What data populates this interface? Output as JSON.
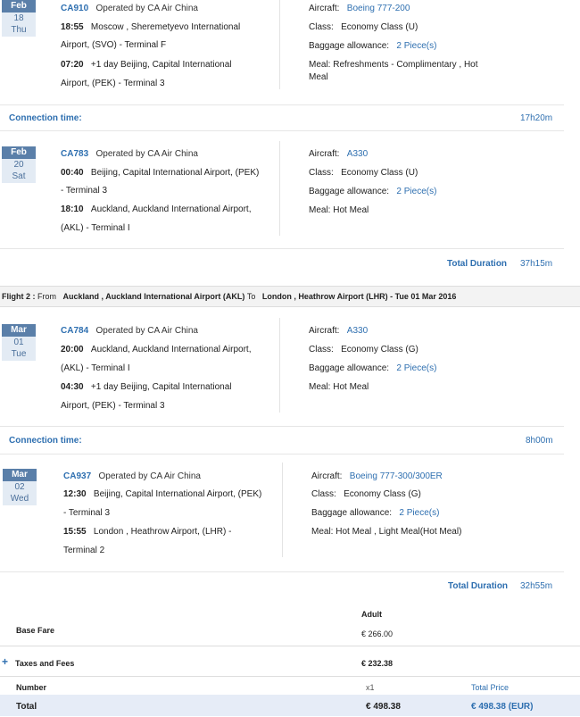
{
  "segments": [
    {
      "month": "Feb",
      "day": "18",
      "weekday": "Thu",
      "code": "CA910",
      "operated_by": "Operated by  CA Air China",
      "dep_time": "18:55",
      "dep_line1": "Moscow , Sheremetyevo International",
      "dep_line2": "Airport, (SVO)   -   Terminal F",
      "arr_time": "07:20",
      "arr_line1": "+1 day Beijing, Capital International",
      "arr_line2": "Airport, (PEK) -    Terminal 3",
      "aircraft_label": "Aircraft:",
      "aircraft": "Boeing 777-200",
      "class_label": "Class:",
      "class": "Economy Class (U)",
      "baggage_label": "Baggage allowance:",
      "baggage": "2 Piece(s)",
      "meal_line1": "Meal: Refreshments - Complimentary , Hot",
      "meal_line2": "Meal"
    },
    {
      "month": "Feb",
      "day": "20",
      "weekday": "Sat",
      "code": "CA783",
      "operated_by": "Operated by  CA Air China",
      "dep_time": "00:40",
      "dep_line1": "Beijing, Capital International Airport, (PEK)",
      "dep_line2": "  -   Terminal 3",
      "arr_time": "18:10",
      "arr_line1": "Auckland, Auckland International Airport,",
      "arr_line2": "(AKL) -    Terminal I",
      "aircraft_label": "Aircraft:",
      "aircraft": "A330",
      "class_label": "Class:",
      "class": "Economy Class (U)",
      "baggage_label": "Baggage allowance:",
      "baggage": "2 Piece(s)",
      "meal_line1": "Meal: Hot Meal",
      "meal_line2": ""
    },
    {
      "month": "Mar",
      "day": "01",
      "weekday": "Tue",
      "code": "CA784",
      "operated_by": "Operated by  CA Air China",
      "dep_time": "20:00",
      "dep_line1": "Auckland, Auckland International Airport,",
      "dep_line2": "(AKL)  -    Terminal I",
      "arr_time": "04:30",
      "arr_line1": "+1 day Beijing, Capital International",
      "arr_line2": "Airport, (PEK) -    Terminal 3",
      "aircraft_label": "Aircraft:",
      "aircraft": "A330",
      "class_label": "Class:",
      "class": "Economy Class (G)",
      "baggage_label": "Baggage allowance:",
      "baggage": "2 Piece(s)",
      "meal_line1": "Meal: Hot Meal",
      "meal_line2": ""
    },
    {
      "month": "Mar",
      "day": "02",
      "weekday": "Wed",
      "code": "CA937",
      "operated_by": "Operated by  CA Air China",
      "dep_time": "12:30",
      "dep_line1": "Beijing, Capital International Airport, (PEK)",
      "dep_line2": "  -   Terminal 3",
      "arr_time": "15:55",
      "arr_line1": "London , Heathrow Airport, (LHR) -",
      "arr_line2": "Terminal 2",
      "aircraft_label": "Aircraft:",
      "aircraft": "Boeing 777-300/300ER",
      "class_label": "Class:",
      "class": "Economy Class (G)",
      "baggage_label": "Baggage allowance:",
      "baggage": "2 Piece(s)",
      "meal_line1": "Meal: Hot Meal , Light Meal(Hot Meal)",
      "meal_line2": ""
    }
  ],
  "connections": [
    {
      "label": "Connection time:",
      "value": "17h20m"
    },
    {
      "label": "Connection time:",
      "value": "8h00m"
    }
  ],
  "durations": [
    {
      "label": "Total Duration",
      "value": "37h15m"
    },
    {
      "label": "Total Duration",
      "value": "32h55m"
    }
  ],
  "flight2_header": {
    "prefix": "Flight 2 : ",
    "from_word": "From",
    "from_place": "Auckland , Auckland International Airport (AKL)",
    "to_word": "To",
    "to_place": "London , Heathrow Airport (LHR) - Tue 01 Mar 2016"
  },
  "pricing": {
    "adult_header": "Adult",
    "base_fare_label": "Base Fare",
    "base_fare_value": "€ 266.00",
    "taxes_label": "Taxes and Fees",
    "taxes_value": "€ 232.38",
    "number_label": "Number",
    "number_value": "x1",
    "total_price_header": "Total Price",
    "total_label": "Total",
    "total_value": "€ 498.38",
    "total_price_value": "€ 498.38 (EUR)"
  }
}
